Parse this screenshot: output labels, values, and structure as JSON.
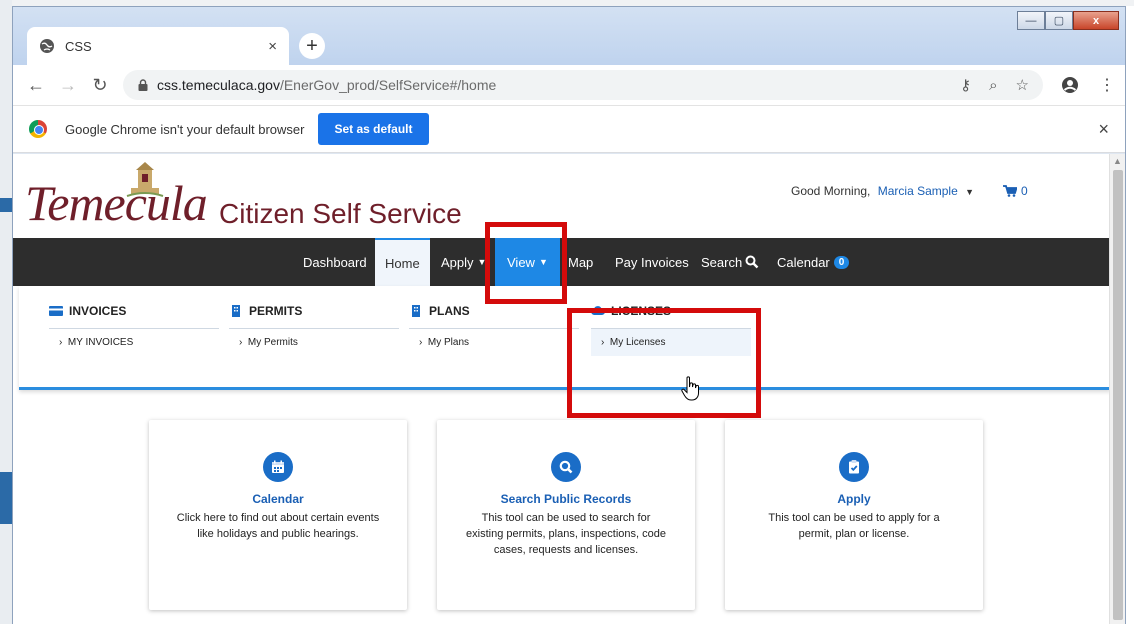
{
  "browser": {
    "tab_title": "CSS",
    "tab_close": "×",
    "new_tab": "+",
    "url_host": "css.temeculaca.gov",
    "url_path": "/EnerGov_prod/SelfService#/home",
    "window_buttons": [
      "—",
      "▢",
      "x"
    ]
  },
  "infobar": {
    "message": "Google Chrome isn't your default browser",
    "button": "Set as default",
    "close": "×"
  },
  "site": {
    "logo_script": "Temecula",
    "logo_sub": "Citizen Self Service",
    "greeting": "Good Morning,",
    "user_name": "Marcia Sample",
    "cart_count": "0"
  },
  "nav": {
    "items": [
      "Dashboard",
      "Home",
      "Apply",
      "View",
      "Map",
      "Pay Invoices",
      "Search",
      "Calendar"
    ],
    "calendar_badge": "0"
  },
  "mega_menu": {
    "columns": [
      {
        "heading": "INVOICES",
        "item": "MY INVOICES",
        "icon": "invoice-icon"
      },
      {
        "heading": "PERMITS",
        "item": "My Permits",
        "icon": "building-icon"
      },
      {
        "heading": "PLANS",
        "item": "My Plans",
        "icon": "building-icon"
      },
      {
        "heading": "LICENSES",
        "item": "My Licenses",
        "icon": "cloud-icon"
      }
    ]
  },
  "cards": [
    {
      "title": "Calendar",
      "desc": "Click here to find out about certain events like holidays and public hearings.",
      "icon": "calendar-icon"
    },
    {
      "title": "Search Public Records",
      "desc": "This tool can be used to search for existing permits, plans, inspections, code cases, requests and licenses.",
      "icon": "search-icon"
    },
    {
      "title": "Apply",
      "desc": "This tool can be used to apply for a permit, plan or license.",
      "icon": "clipboard-check-icon"
    }
  ],
  "colors": {
    "brand_maroon": "#6f1f2a",
    "accent_blue": "#1e88e5",
    "link_blue": "#1a5fb4",
    "navbar_dark": "#2d2d2d",
    "annotation_red": "#d40b0b"
  }
}
